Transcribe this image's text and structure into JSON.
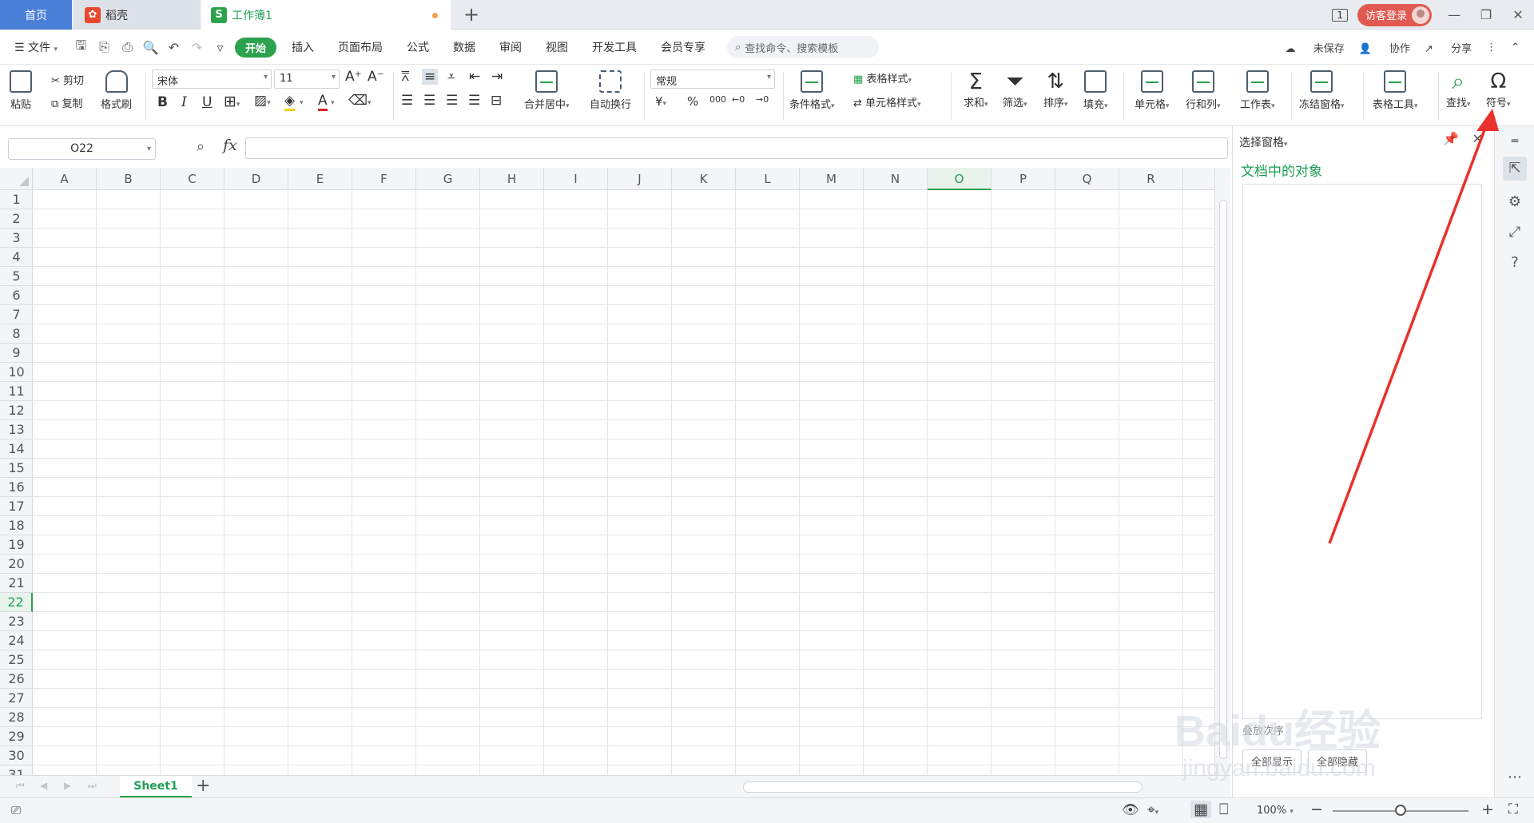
{
  "tabs": {
    "home": "首页",
    "daoke": "稻壳",
    "book": "工作簿1",
    "book_icon": "S"
  },
  "window": {
    "page_count": "1",
    "visitor_login": "访客登录"
  },
  "menu": {
    "file": "文件",
    "items": [
      "开始",
      "插入",
      "页面布局",
      "公式",
      "数据",
      "审阅",
      "视图",
      "开发工具",
      "会员专享"
    ],
    "search_placeholder": "查找命令、搜索模板",
    "unsaved": "未保存",
    "collab": "协作",
    "share": "分享"
  },
  "ribbon": {
    "paste": "粘贴",
    "cut": "剪切",
    "copy": "复制",
    "format_painter": "格式刷",
    "font_name": "宋体",
    "font_size": "11",
    "merge_center": "合并居中",
    "wrap": "自动换行",
    "number_format": "常规",
    "cond_format": "条件格式",
    "table_style": "表格样式",
    "cell_style": "单元格样式",
    "sum": "求和",
    "filter": "筛选",
    "sort": "排序",
    "fill": "填充",
    "cell": "单元格",
    "row_col": "行和列",
    "worksheet": "工作表",
    "freeze": "冻结窗格",
    "table_tools": "表格工具",
    "find": "查找",
    "symbol": "符号"
  },
  "formula_bar": {
    "name_box": "O22",
    "fx": "fx",
    "value": ""
  },
  "grid": {
    "columns": [
      "A",
      "B",
      "C",
      "D",
      "E",
      "F",
      "G",
      "H",
      "I",
      "J",
      "K",
      "L",
      "M",
      "N",
      "O",
      "P",
      "Q",
      "R"
    ],
    "rows": [
      "1",
      "2",
      "3",
      "4",
      "5",
      "6",
      "7",
      "8",
      "9",
      "10",
      "11",
      "12",
      "13",
      "14",
      "15",
      "16",
      "17",
      "18",
      "19",
      "20",
      "21",
      "22",
      "23",
      "24",
      "25",
      "26",
      "27",
      "28",
      "29",
      "30",
      "31"
    ],
    "active_column": "O",
    "active_row": "22"
  },
  "sheets": {
    "tabs": [
      "Sheet1"
    ]
  },
  "status": {
    "zoom": "100%"
  },
  "pane": {
    "title": "选择窗格",
    "heading": "文档中的对象",
    "bottom_label": "叠放次序",
    "show_all": "全部显示",
    "hide_all": "全部隐藏"
  },
  "watermark": {
    "text": "Baidu经验",
    "url": "jingyan.baidu.com"
  },
  "colors": {
    "accent": "#2ba24c",
    "annotation": "#e8322b",
    "home_tab": "#4a7fd8"
  }
}
